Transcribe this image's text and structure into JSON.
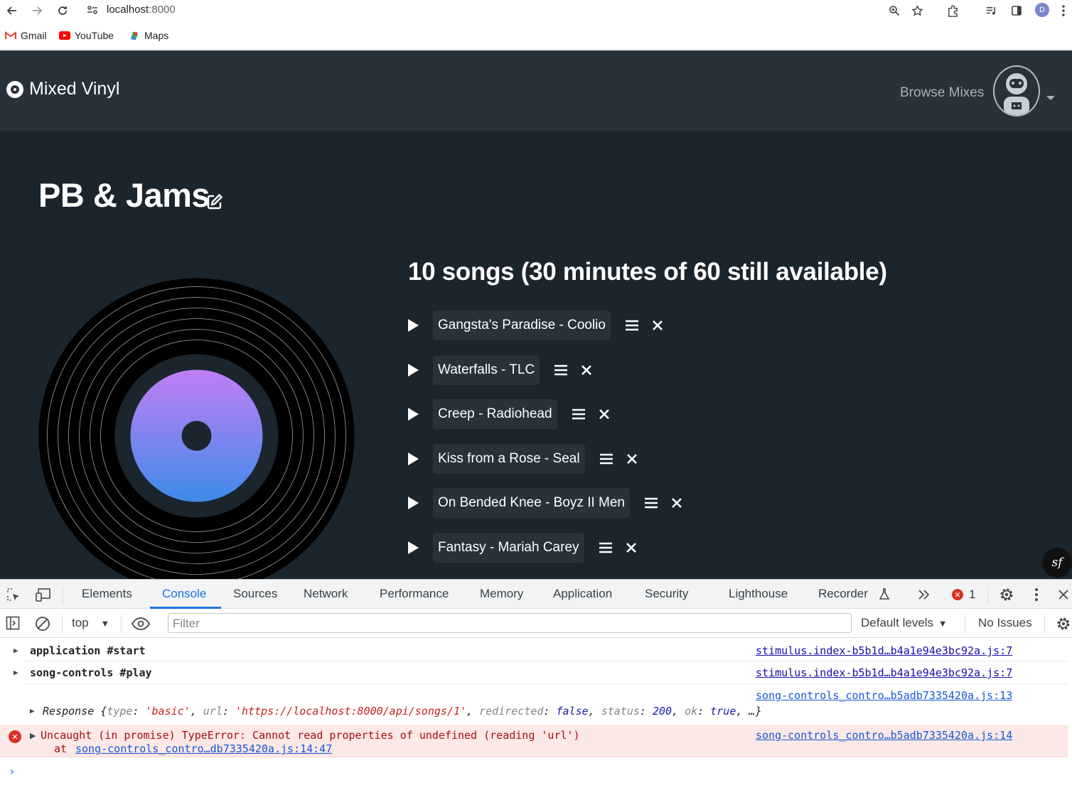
{
  "browser": {
    "url_host": "localhost",
    "url_port": ":8000",
    "profile_initial": "D",
    "bookmarks": [
      {
        "label": "Gmail",
        "icon": "gmail-icon"
      },
      {
        "label": "YouTube",
        "icon": "youtube-icon"
      },
      {
        "label": "Maps",
        "icon": "maps-icon"
      }
    ]
  },
  "app": {
    "brand": "Mixed Vinyl",
    "nav_browse": "Browse Mixes",
    "title": "PB & Jams",
    "songs_heading": "10 songs (30 minutes of 60 still available)",
    "songs": [
      "Gangsta's Paradise - Coolio",
      "Waterfalls - TLC",
      "Creep - Radiohead",
      "Kiss from a Rose - Seal",
      "On Bended Knee - Boyz II Men",
      "Fantasy - Mariah Carey"
    ],
    "colors": {
      "background": "#1b252e",
      "navbar": "#27323b",
      "label_gradient_top": "#c27ef5",
      "label_gradient_bottom": "#3d8be8"
    }
  },
  "devtools": {
    "tabs": [
      "Elements",
      "Console",
      "Sources",
      "Network",
      "Performance",
      "Memory",
      "Application",
      "Security",
      "Lighthouse",
      "Recorder"
    ],
    "active_tab": "Console",
    "error_count": "1",
    "context": "top",
    "filter_placeholder": "Filter",
    "levels": "Default levels",
    "issues": "No Issues",
    "messages": [
      {
        "text": "application #start",
        "source": "stimulus.index-b5b1d…b4a1e94e3bc92a.js:7"
      },
      {
        "text": "song-controls #play",
        "source": "stimulus.index-b5b1d…b4a1e94e3bc92a.js:7"
      },
      {
        "source": "song-controls_contro…b5adb7335420a.js:13"
      },
      {
        "source": "song-controls_contro…b5adb7335420a.js:14"
      }
    ],
    "response_line": {
      "prefix": "Response {",
      "k1": "type",
      "v1": "'basic'",
      "k2": "url",
      "v2": "'https://localhost:8000/api/songs/1'",
      "k3": "redirected",
      "v3": "false",
      "k4": "status",
      "v4": "200",
      "k5": "ok",
      "v5": "true",
      "suffix": ", …}"
    },
    "error_text": "Uncaught (in promise) TypeError: Cannot read properties of undefined (reading 'url')",
    "error_at": "at",
    "error_at_link": "song-controls_contro…db7335420a.js:14:47"
  }
}
